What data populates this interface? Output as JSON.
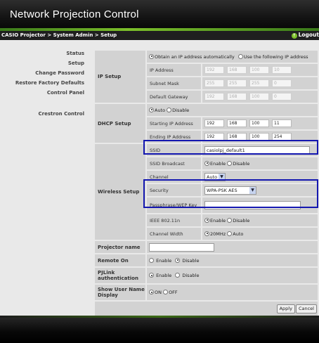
{
  "app": {
    "title": "Network Projection Control"
  },
  "header": {
    "breadcrumb": "CASIO Projector > System Admin > Setup",
    "logout_label": "Logout",
    "logout_icon": "upload-arrow-icon"
  },
  "sidebar": {
    "items": [
      {
        "label": "Status"
      },
      {
        "label": "Setup"
      },
      {
        "label": "Change Password"
      },
      {
        "label": "Restore Factory Defaults"
      },
      {
        "label": "Control Panel"
      },
      {
        "label": "Crestron Control"
      }
    ]
  },
  "form": {
    "ip_setup": {
      "label": "IP Setup",
      "opt_auto": "Obtain an IP address automatically",
      "opt_manual": "Use the following IP address",
      "ip_address_label": "IP Address",
      "ip_address": [
        "192",
        "168",
        "100",
        "10"
      ],
      "subnet_label": "Subnet Mask",
      "subnet": [
        "255",
        "255",
        "255",
        "0"
      ],
      "gateway_label": "Default Gateway",
      "gateway": [
        "192",
        "168",
        "100",
        "0"
      ]
    },
    "dhcp": {
      "label": "DHCP Setup",
      "opt_auto": "Auto",
      "opt_disable": "Disable",
      "start_label": "Starting IP Address",
      "start": [
        "192",
        "168",
        "100",
        "11"
      ],
      "end_label": "Ending IP Address",
      "end": [
        "192",
        "168",
        "100",
        "254"
      ]
    },
    "wireless": {
      "label": "Wireless Setup",
      "ssid_label": "SSID",
      "ssid_value": "casiolpj_default1",
      "broadcast_label": "SSID Broadcast",
      "enable": "Enable",
      "disable": "Disable",
      "channel_label": "Channel",
      "channel_value": "Auto",
      "security_label": "Security",
      "security_value": "WPA-PSK AES",
      "passphrase_label": "Passphrase/WEP Key",
      "passphrase_value": "",
      "ieee_label": "IEEE 802.11n",
      "width_label": "Channel Width",
      "width_20": "20MHz",
      "width_auto": "Auto"
    },
    "projector_name": {
      "label": "Projector name",
      "value": ""
    },
    "remote_on": {
      "label": "Remote On",
      "enable": "Enable",
      "disable": "Disable"
    },
    "pjlink": {
      "label": "PJLink authentication",
      "enable": "Enable",
      "disable": "Disable"
    },
    "show_user": {
      "label": "Show User Name Display",
      "on": "ON",
      "off": "OFF"
    },
    "apply_label": "Apply",
    "cancel_label": "Cancel"
  },
  "colors": {
    "highlight": "#1417b0",
    "brand_green": "#7cbf2a",
    "header_bg": "#141414",
    "panel_bg": "#e9e9e9",
    "cell_bg": "#d2d2d2"
  }
}
